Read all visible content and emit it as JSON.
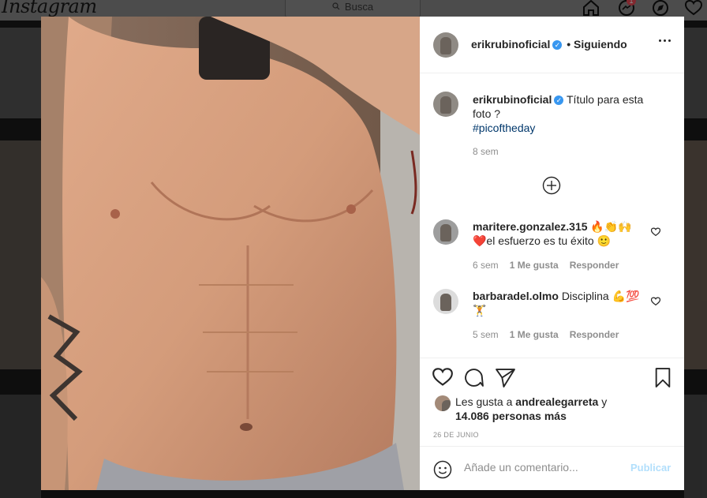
{
  "app": {
    "logo": "Instagram",
    "search_placeholder": "Busca",
    "notifications_count": "1"
  },
  "post": {
    "author": "erikrubinoficial",
    "follow_status": "• Siguiendo",
    "caption": "Título para esta foto ?",
    "hashtag": "#picoftheday",
    "time_ago": "8 sem",
    "comments": [
      {
        "user": "maritere.gonzalez.315",
        "text": "🔥👏🙌 ❤️el esfuerzo es tu éxito 🙂",
        "time": "6 sem",
        "likes": "1 Me gusta",
        "reply": "Responder"
      },
      {
        "user": "barbaradel.olmo",
        "text": "Disciplina 💪💯 🏋",
        "time": "5 sem",
        "likes": "1 Me gusta",
        "reply": "Responder"
      }
    ],
    "likes_prefix": "Les gusta a",
    "liked_by": "andrealegarreta",
    "likes_conj": "y",
    "likes_others": "14.086 personas más",
    "date": "26 DE JUNIO",
    "comment_placeholder": "Añade un comentario...",
    "publish_label": "Publicar"
  },
  "icons": {
    "home": "home-icon",
    "messages": "messenger-icon",
    "explore": "compass-icon",
    "activity": "heart-icon",
    "like": "heart-icon",
    "comment": "comment-icon",
    "share": "send-icon",
    "save": "bookmark-icon",
    "emoji": "smiley-icon",
    "load_more": "plus-circle-icon"
  },
  "colors": {
    "accent": "#3897f0",
    "hashtag": "#00376b",
    "publish_disabled": "#b2dffc",
    "notification": "#ed4956"
  }
}
